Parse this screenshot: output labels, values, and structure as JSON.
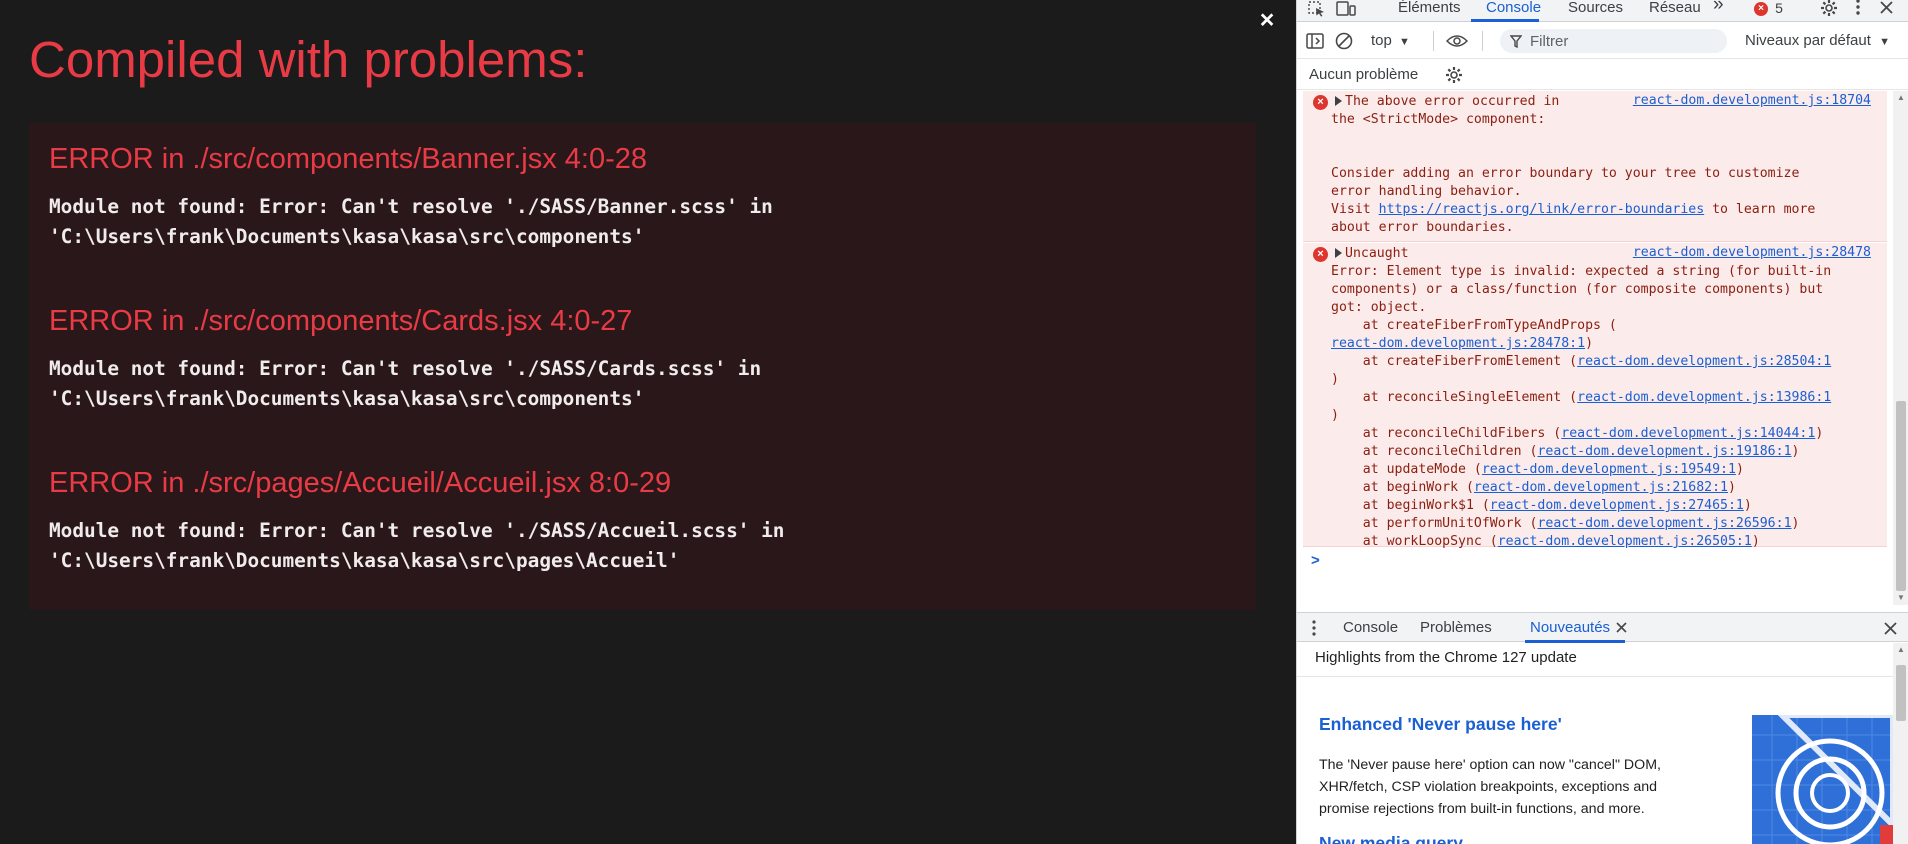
{
  "overlay": {
    "close_glyph": "×",
    "title": "Compiled with problems:",
    "errors": [
      {
        "heading": "ERROR in ./src/components/Banner.jsx 4:0-28",
        "message": "Module not found: Error: Can't resolve './SASS/Banner.scss' in\n'C:\\Users\\frank\\Documents\\kasa\\kasa\\src\\components'"
      },
      {
        "heading": "ERROR in ./src/components/Cards.jsx 4:0-27",
        "message": "Module not found: Error: Can't resolve './SASS/Cards.scss' in\n'C:\\Users\\frank\\Documents\\kasa\\kasa\\src\\components'"
      },
      {
        "heading": "ERROR in ./src/pages/Accueil/Accueil.jsx 8:0-29",
        "message": "Module not found: Error: Can't resolve './SASS/Accueil.scss' in\n'C:\\Users\\frank\\Documents\\kasa\\kasa\\src\\pages\\Accueil'"
      }
    ]
  },
  "devtools": {
    "tabs": {
      "elements": "Éléments",
      "console": "Console",
      "sources": "Sources",
      "network": "Réseau",
      "more": "»",
      "error_count": "5"
    },
    "toolbar": {
      "context": "top",
      "filter_placeholder": "Filtrer",
      "levels": "Niveaux par défaut"
    },
    "issues_label": "Aucun problème",
    "messages": {
      "msg1": {
        "source": "react-dom.development.js:18704",
        "line1": "The above error occurred in",
        "line2": "the <StrictMode> component:",
        "body": "Consider adding an error boundary to your tree to customize\nerror handling behavior.",
        "visit": "Visit ",
        "link": "https://reactjs.org/link/error-boundaries",
        "after_link": " to learn more",
        "last": "about error boundaries."
      },
      "msg2": {
        "source": "react-dom.development.js:28478",
        "title": "Uncaught",
        "error_text": "Error: Element type is invalid: expected a string (for built-in\ncomponents) or a class/function (for composite components) but\ngot: object.",
        "frames": [
          {
            "fn": "    at createFiberFromTypeAndProps (",
            "link": "",
            "end": ""
          },
          {
            "fn": "",
            "link": "react-dom.development.js:28478:1",
            "end": ")"
          },
          {
            "fn": "    at createFiberFromElement (",
            "link": "react-dom.development.js:28504:1",
            "end": ""
          },
          {
            "fn": ")",
            "link": "",
            "end": ""
          },
          {
            "fn": "    at reconcileSingleElement (",
            "link": "react-dom.development.js:13986:1",
            "end": ""
          },
          {
            "fn": ")",
            "link": "",
            "end": ""
          },
          {
            "fn": "    at reconcileChildFibers (",
            "link": "react-dom.development.js:14044:1",
            "end": ")"
          },
          {
            "fn": "    at reconcileChildren (",
            "link": "react-dom.development.js:19186:1",
            "end": ")"
          },
          {
            "fn": "    at updateMode (",
            "link": "react-dom.development.js:19549:1",
            "end": ")"
          },
          {
            "fn": "    at beginWork (",
            "link": "react-dom.development.js:21682:1",
            "end": ")"
          },
          {
            "fn": "    at beginWork$1 (",
            "link": "react-dom.development.js:27465:1",
            "end": ")"
          },
          {
            "fn": "    at performUnitOfWork (",
            "link": "react-dom.development.js:26596:1",
            "end": ")"
          },
          {
            "fn": "    at workLoopSync (",
            "link": "react-dom.development.js:26505:1",
            "end": ")"
          }
        ]
      }
    },
    "prompt_glyph": ">",
    "drawer": {
      "tabs": {
        "console": "Console",
        "problems": "Problèmes",
        "whatsnew": "Nouveautés"
      },
      "subtitle": "Highlights from the Chrome 127 update",
      "feature_title": "Enhanced 'Never pause here'",
      "feature_desc": "The 'Never pause here' option can now \"cancel\" DOM, XHR/fetch, CSP violation breakpoints, exceptions and promise rejections from built-in functions, and more.",
      "next_title": "New media query ..."
    }
  }
}
